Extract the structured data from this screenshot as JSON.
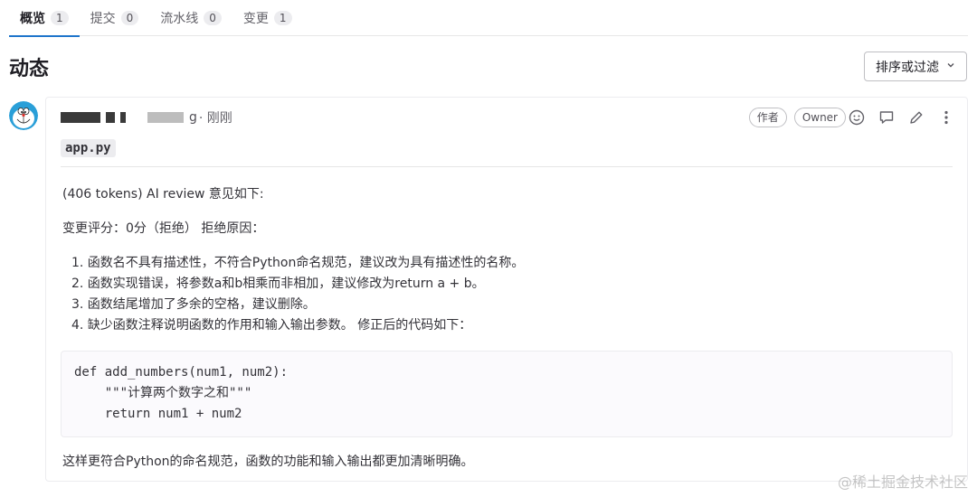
{
  "tabs": [
    {
      "label": "概览",
      "count": "1"
    },
    {
      "label": "提交",
      "count": "0"
    },
    {
      "label": "流水线",
      "count": "0"
    },
    {
      "label": "变更",
      "count": "1"
    }
  ],
  "header": {
    "title": "动态",
    "sort_label": "排序或过滤"
  },
  "note": {
    "author_suffix": "g",
    "time": "· 刚刚",
    "badges": {
      "author": "作者",
      "role": "Owner"
    },
    "file_name": "app.py",
    "intro": "(406 tokens) AI review 意见如下:",
    "score": "变更评分：0分（拒绝） 拒绝原因：",
    "reasons": [
      "1. 函数名不具有描述性，不符合Python命名规范，建议改为具有描述性的名称。",
      "2. 函数实现错误，将参数a和b相乘而非相加，建议修改为return a + b。",
      "3. 函数结尾增加了多余的空格，建议删除。",
      "4. 缺少函数注释说明函数的作用和输入输出参数。 修正后的代码如下："
    ],
    "code_lines": [
      "def add_numbers(num1, num2):",
      "    \"\"\"计算两个数字之和\"\"\"",
      "    return num1 + num2"
    ],
    "conclusion": "这样更符合Python的命名规范，函数的功能和输入输出都更加清晰明确。"
  },
  "watermark": "@稀土掘金技术社区",
  "icons": {
    "emoji": "smiley-icon",
    "reply": "comment-icon",
    "edit": "pencil-icon",
    "more": "more-vertical-icon"
  },
  "colors": {
    "tab_underline": "#1f75cb",
    "text": "#333238",
    "border": "#ececef"
  }
}
